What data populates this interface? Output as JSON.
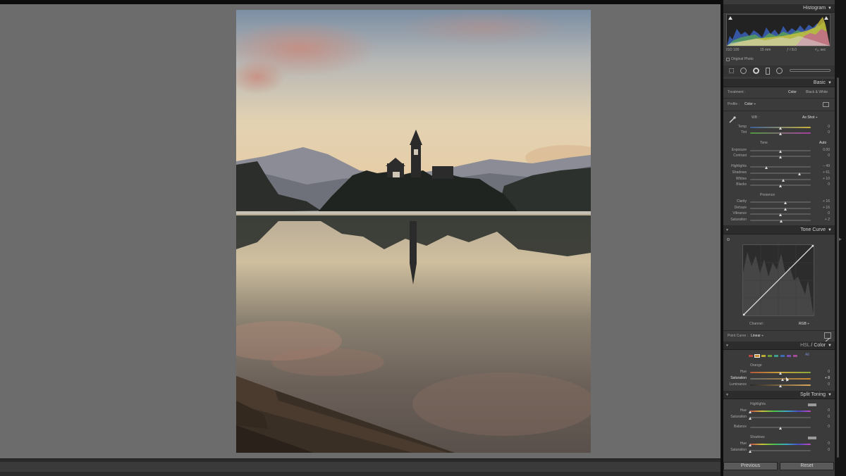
{
  "panels": {
    "histogram": {
      "title": "Histogram",
      "iso": "ISO 100",
      "focal": "15 mm",
      "aperture": "ƒ / 8.0",
      "shutter": "¹⁄₁₀ sec",
      "original_photo_label": "Original Photo"
    },
    "basic": {
      "title": "Basic",
      "treatment_label": "Treatment :",
      "treatment_color": "Color",
      "treatment_bw": "Black & White",
      "profile_label": "Profile :",
      "profile_value": "Color ÷",
      "wb_label": "WB :",
      "wb_value": "As Shot ÷",
      "tone_label": "Tone",
      "auto_label": "Auto",
      "presence_label": "Presence",
      "sliders": [
        {
          "label": "Temp",
          "value": "0"
        },
        {
          "label": "Tint",
          "value": "0"
        },
        {
          "label": "Exposure",
          "value": "0.00"
        },
        {
          "label": "Contrast",
          "value": "0"
        },
        {
          "label": "Highlights",
          "value": "– 49"
        },
        {
          "label": "Shadows",
          "value": "+ 61"
        },
        {
          "label": "Whites",
          "value": "+ 10"
        },
        {
          "label": "Blacks",
          "value": "0"
        },
        {
          "label": "Clarity",
          "value": "+ 16"
        },
        {
          "label": "Dehaze",
          "value": "+ 16"
        },
        {
          "label": "Vibrance",
          "value": "0"
        },
        {
          "label": "Saturation",
          "value": "+ 2"
        }
      ]
    },
    "tone_curve": {
      "title": "Tone Curve",
      "channel_label": "Channel :",
      "channel_value": "RGB ÷",
      "point_curve_label": "Point Curve :",
      "point_curve_value": "Linear ÷"
    },
    "hsl": {
      "title_hsl": "HSL",
      "title_sep": " / ",
      "title_color": "Color",
      "all_label": "All",
      "group_label": "Orange",
      "swatch_colors": [
        "#b5473e",
        "#c98a2e",
        "#b8ac35",
        "#6d9c3a",
        "#3e9c8c",
        "#3c6cb0",
        "#7a4fb0",
        "#a34a95"
      ],
      "sliders": [
        {
          "label": "Hue",
          "value": "0"
        },
        {
          "label": "Saturation",
          "value": "+ 8"
        },
        {
          "label": "Luminance",
          "value": "0"
        }
      ]
    },
    "split_toning": {
      "title": "Split Toning",
      "highlights_label": "Highlights",
      "shadows_label": "Shadows",
      "balance_label": "Balance",
      "sliders": [
        {
          "label": "Hue",
          "value": "0"
        },
        {
          "label": "Saturation",
          "value": "0"
        },
        {
          "label": "Balance",
          "value": "0"
        },
        {
          "label": "Hue",
          "value": "0"
        },
        {
          "label": "Saturation",
          "value": "0"
        }
      ]
    }
  },
  "buttons": {
    "previous": "Previous",
    "reset": "Reset"
  },
  "colors": {
    "canvas_bg": "#6c6c6c",
    "panel_bg": "#3b3b3b",
    "header_bg": "#2c2c2c"
  }
}
